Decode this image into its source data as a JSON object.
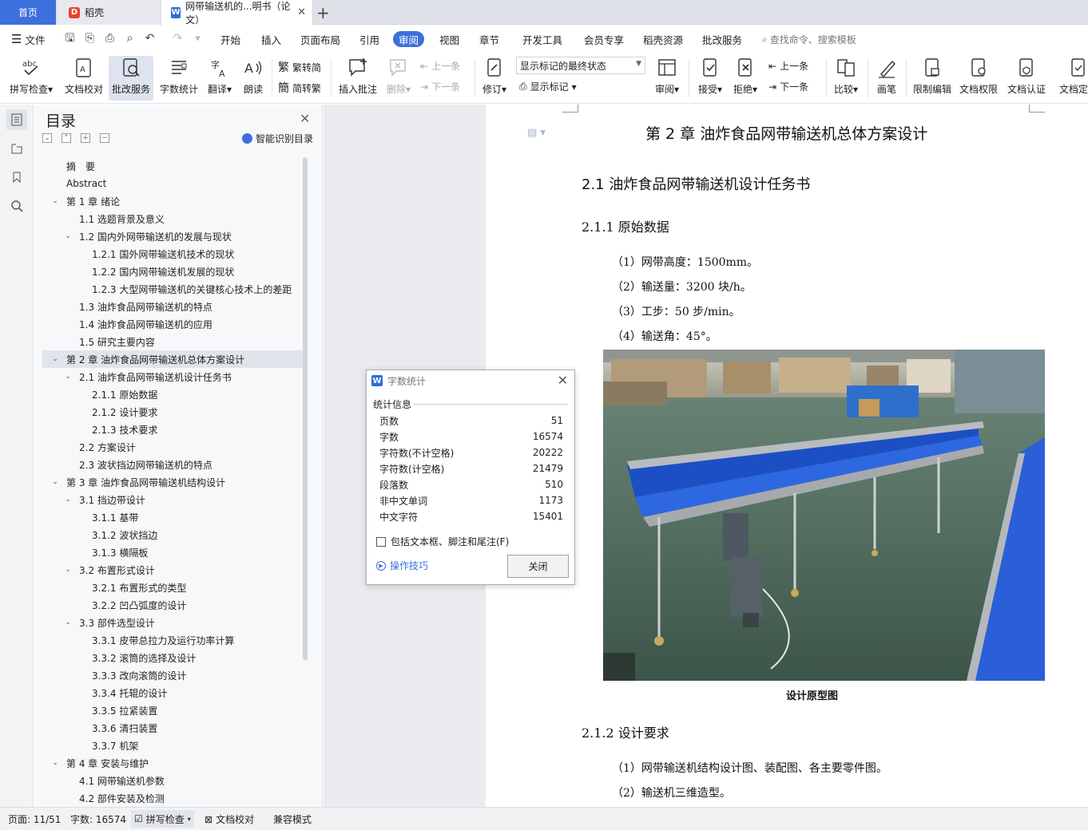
{
  "tabs": {
    "home": "首页",
    "daoke": "稻壳",
    "document": "网带输送机的...明书（论文）"
  },
  "menu": {
    "file": "文件",
    "items": [
      "开始",
      "插入",
      "页面布局",
      "引用",
      "审阅",
      "视图",
      "章节",
      "开发工具",
      "会员专享",
      "稻壳资源",
      "批改服务"
    ],
    "active_index": 4,
    "search_placeholder": "查找命令、搜索模板"
  },
  "toolbar": {
    "spell_check": "拼写检查",
    "doc_proof": "文档校对",
    "review_service": "批改服务",
    "word_count": "字数统计",
    "translate": "翻译",
    "read_aloud": "朗读",
    "to_traditional": "繁转简",
    "to_simplified": "简转繁",
    "insert_comment": "插入批注",
    "delete": "删除",
    "prev_comment": "上一条",
    "next_comment": "下一条",
    "track_changes": "修订",
    "markup_state": "显示标记的最终状态",
    "show_markup": "显示标记",
    "review_pane": "审阅",
    "accept": "接受",
    "reject": "拒绝",
    "prev_change": "上一条",
    "next_change": "下一条",
    "compare": "比较",
    "pen": "画笔",
    "restrict_edit": "限制编辑",
    "doc_permission": "文档权限",
    "doc_auth": "文档认证",
    "doc_finalize": "文档定稿"
  },
  "toc": {
    "title": "目录",
    "smart_label": "智能识别目录",
    "items": [
      {
        "label": "摘　要",
        "level": 0,
        "caret": ""
      },
      {
        "label": "Abstract",
        "level": 0,
        "caret": ""
      },
      {
        "label": "第 1 章  绪论",
        "level": 0,
        "caret": "v"
      },
      {
        "label": "1.1 选题背景及意义",
        "level": 1,
        "caret": ""
      },
      {
        "label": "1.2  国内外网带输送机的发展与现状",
        "level": 1,
        "caret": "v"
      },
      {
        "label": "1.2.1 国外网带输送机技术的现状",
        "level": 2,
        "caret": ""
      },
      {
        "label": "1.2.2  国内网带输送机发展的现状",
        "level": 2,
        "caret": ""
      },
      {
        "label": "1.2.3  大型网带输送机的关键核心技术上的差距",
        "level": 2,
        "caret": ""
      },
      {
        "label": "1.3 油炸食品网带输送机的特点",
        "level": 1,
        "caret": ""
      },
      {
        "label": "1.4 油炸食品网带输送机的应用",
        "level": 1,
        "caret": ""
      },
      {
        "label": "1.5  研究主要内容",
        "level": 1,
        "caret": ""
      },
      {
        "label": "第 2 章  油炸食品网带输送机总体方案设计",
        "level": 0,
        "caret": "v",
        "selected": true
      },
      {
        "label": "2.1  油炸食品网带输送机设计任务书",
        "level": 1,
        "caret": "v"
      },
      {
        "label": "2.1.1 原始数据",
        "level": 2,
        "caret": ""
      },
      {
        "label": "2.1.2 设计要求",
        "level": 2,
        "caret": ""
      },
      {
        "label": "2.1.3 技术要求",
        "level": 2,
        "caret": ""
      },
      {
        "label": "2.2  方案设计",
        "level": 1,
        "caret": ""
      },
      {
        "label": "2.3  波状挡边网带输送机的特点",
        "level": 1,
        "caret": ""
      },
      {
        "label": "第 3 章  油炸食品网带输送机结构设计",
        "level": 0,
        "caret": "v"
      },
      {
        "label": "3.1 挡边带设计",
        "level": 1,
        "caret": "v"
      },
      {
        "label": "3.1.1  基带",
        "level": 2,
        "caret": ""
      },
      {
        "label": "3.1.2  波状挡边",
        "level": 2,
        "caret": ""
      },
      {
        "label": "3.1.3  横隔板",
        "level": 2,
        "caret": ""
      },
      {
        "label": "3.2 布置形式设计",
        "level": 1,
        "caret": "v"
      },
      {
        "label": "3.2.1  布置形式的类型",
        "level": 2,
        "caret": ""
      },
      {
        "label": "3.2.2 凹凸弧度的设计",
        "level": 2,
        "caret": ""
      },
      {
        "label": "3.3 部件选型设计",
        "level": 1,
        "caret": "v"
      },
      {
        "label": "3.3.1 皮带总拉力及运行功率计算",
        "level": 2,
        "caret": ""
      },
      {
        "label": "3.3.2 滚筒的选择及设计",
        "level": 2,
        "caret": ""
      },
      {
        "label": "3.3.3 改向滚筒的设计",
        "level": 2,
        "caret": ""
      },
      {
        "label": "3.3.4 托辊的设计",
        "level": 2,
        "caret": ""
      },
      {
        "label": "3.3.5 拉紧装置",
        "level": 2,
        "caret": ""
      },
      {
        "label": "3.3.6 清扫装置",
        "level": 2,
        "caret": ""
      },
      {
        "label": "3.3.7 机架",
        "level": 2,
        "caret": ""
      },
      {
        "label": "第 4 章  安装与维护",
        "level": 0,
        "caret": "v"
      },
      {
        "label": "4.1 网带输送机参数",
        "level": 1,
        "caret": ""
      },
      {
        "label": "4.2 部件安装及检测",
        "level": 1,
        "caret": ""
      }
    ]
  },
  "doc": {
    "chapter_title": "第 2 章  油炸食品网带输送机总体方案设计",
    "section_21": "2.1  油炸食品网带输送机设计任务书",
    "sub_211": "2.1.1 原始数据",
    "params": [
      "（1）网带高度：1500mm。",
      "（2）输送量：3200 块/h。",
      "（3）工步：50 步/min。",
      "（4）输送角：45°。"
    ],
    "figure_caption": "设计原型图",
    "sub_212": "2.1.2 设计要求",
    "reqs": [
      "（1）网带输送机结构设计图、装配图、各主要零件图。",
      "（2）输送机三维造型。"
    ]
  },
  "dialog": {
    "title": "字数统计",
    "section": "统计信息",
    "rows": [
      {
        "label": "页数",
        "value": "51"
      },
      {
        "label": "字数",
        "value": "16574"
      },
      {
        "label": "字符数(不计空格)",
        "value": "20222"
      },
      {
        "label": "字符数(计空格)",
        "value": "21479"
      },
      {
        "label": "段落数",
        "value": "510"
      },
      {
        "label": "非中文单词",
        "value": "1173"
      },
      {
        "label": "中文字符",
        "value": "15401"
      }
    ],
    "checkbox_label": "包括文本框、脚注和尾注(F)",
    "tips": "操作技巧",
    "close": "关闭"
  },
  "status": {
    "page": "页面: 11/51",
    "words": "字数: 16574",
    "spell": "拼写检查",
    "proof": "文档校对",
    "compat": "兼容模式"
  },
  "colors": {
    "accent": "#3d6fdd",
    "belt": "#1f5fd6"
  }
}
